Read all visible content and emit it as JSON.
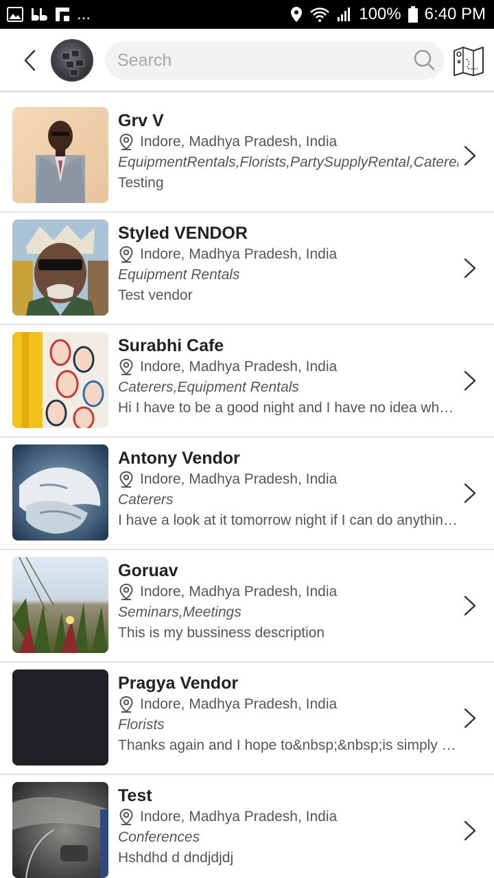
{
  "status_bar": {
    "icons_left": [
      "gallery-icon",
      "bb-icon",
      "flipboard-icon"
    ],
    "more": "...",
    "battery": "100%",
    "time": "6:40 PM"
  },
  "header": {
    "search_placeholder": "Search",
    "search_value": ""
  },
  "vendors": [
    {
      "name": "Grv V",
      "location": "Indore, Madhya Pradesh, India",
      "categories": "EquipmentRentals,Florists,PartySupplyRental,Caterers",
      "description": "Testing",
      "thumb": "man-in-suit"
    },
    {
      "name": "Styled VENDOR",
      "location": "Indore, Madhya Pradesh, India",
      "categories": "Equipment Rentals",
      "description": "Test vendor",
      "thumb": "cartoon-character"
    },
    {
      "name": "Surabhi Cafe",
      "location": "Indore, Madhya Pradesh, India",
      "categories": "Caterers,Equipment Rentals",
      "description": "Hi I have to be a good night and I have no idea what…",
      "thumb": "illustrated-faces"
    },
    {
      "name": "Antony Vendor",
      "location": "Indore, Madhya Pradesh, India",
      "categories": "Caterers",
      "description": "I have a look at it tomorrow night if I can do anythin…",
      "thumb": "holding-hands"
    },
    {
      "name": "Goruav",
      "location": "Indore, Madhya Pradesh, India",
      "categories": "Seminars,Meetings",
      "description": "This is my bussiness description",
      "thumb": "beach-plants"
    },
    {
      "name": "Pragya Vendor",
      "location": "Indore, Madhya Pradesh, India",
      "categories": "Florists",
      "description": "Thanks again and I hope to&nbsp;&nbsp;is simply d…",
      "thumb": "dark-blank"
    },
    {
      "name": "Test",
      "location": "Indore, Madhya Pradesh, India",
      "categories": "Conferences",
      "description": "Hshdhd d dndjdjdj",
      "thumb": "dark-interior"
    }
  ]
}
